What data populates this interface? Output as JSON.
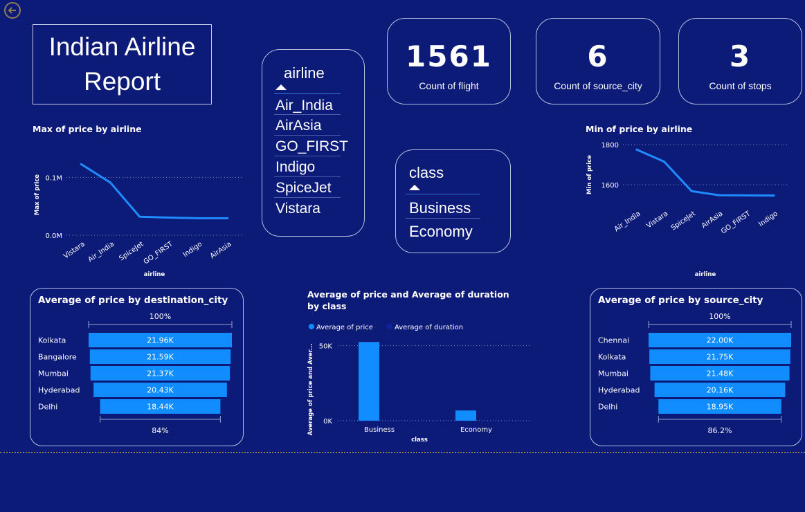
{
  "report_title": "Indian Airline Report",
  "kpis": [
    {
      "value": "1561",
      "label": "Count of flight"
    },
    {
      "value": "6",
      "label": "Count of source_city"
    },
    {
      "value": "3",
      "label": "Count of stops"
    }
  ],
  "slicers": {
    "airline": {
      "title": "airline",
      "items": [
        "Air_India",
        "AirAsia",
        "GO_FIRST",
        "Indigo",
        "SpiceJet",
        "Vistara"
      ]
    },
    "class": {
      "title": "class",
      "items": [
        "Business",
        "Economy"
      ]
    }
  },
  "colors": {
    "background": "#0c1a78",
    "accent": "#118dff",
    "line": "#1f8cff"
  },
  "icons": {
    "back": "back-arrow-icon",
    "sort": "sort-caret-icon"
  },
  "chart_data": [
    {
      "id": "max_price",
      "type": "line",
      "title": "Max of price by airline",
      "xlabel": "airline",
      "ylabel": "Max of price",
      "categories": [
        "Vistara",
        "Air_India",
        "SpiceJet",
        "GO_FIRST",
        "Indigo",
        "AirAsia"
      ],
      "values": [
        123000,
        91000,
        32000,
        30500,
        29500,
        29500
      ],
      "ylim": [
        0,
        140000
      ],
      "yticks": [
        {
          "value": 0,
          "label": "0.0M"
        },
        {
          "value": 100000,
          "label": "0.1M"
        }
      ],
      "grid": true
    },
    {
      "id": "min_price",
      "type": "line",
      "title": "Min of price by airline",
      "xlabel": "airline",
      "ylabel": "Min of price",
      "categories": [
        "Air_India",
        "Vistara",
        "SpiceJet",
        "AirAsia",
        "GO_FIRST",
        "Indigo"
      ],
      "values": [
        1775,
        1715,
        1568,
        1548,
        1547,
        1546
      ],
      "ylim": [
        1500,
        1800
      ],
      "yticks": [
        {
          "value": 1600,
          "label": "1600"
        },
        {
          "value": 1800,
          "label": "1800"
        }
      ],
      "grid": true
    },
    {
      "id": "dest_funnel",
      "type": "bar",
      "title": "Average of price by destination_city",
      "categories": [
        "Kolkata",
        "Bangalore",
        "Mumbai",
        "Hyderabad",
        "Delhi"
      ],
      "values": [
        21960,
        21590,
        21370,
        20430,
        18440
      ],
      "labels": [
        "21.96K",
        "21.59K",
        "21.37K",
        "20.43K",
        "18.44K"
      ],
      "top_pct": "100%",
      "bottom_pct": "84%"
    },
    {
      "id": "class_bars",
      "type": "bar",
      "title": "Average of price and Average of duration by class",
      "xlabel": "class",
      "ylabel": "Average of price and Aver...",
      "categories": [
        "Business",
        "Economy"
      ],
      "series": [
        {
          "name": "Average of price",
          "values": [
            52500,
            6800
          ],
          "color": "#118dff"
        },
        {
          "name": "Average of duration",
          "values": [
            12,
            11
          ],
          "color": "#12239e"
        }
      ],
      "ylim": [
        0,
        60000
      ],
      "yticks": [
        {
          "value": 0,
          "label": "0K"
        },
        {
          "value": 50000,
          "label": "50K"
        }
      ],
      "legend": "top-left",
      "grid": true
    },
    {
      "id": "source_funnel",
      "type": "bar",
      "title": "Average of price by source_city",
      "categories": [
        "Chennai",
        "Kolkata",
        "Mumbai",
        "Hyderabad",
        "Delhi"
      ],
      "values": [
        22000,
        21750,
        21480,
        20160,
        18950
      ],
      "labels": [
        "22.00K",
        "21.75K",
        "21.48K",
        "20.16K",
        "18.95K"
      ],
      "top_pct": "100%",
      "bottom_pct": "86.2%"
    }
  ]
}
